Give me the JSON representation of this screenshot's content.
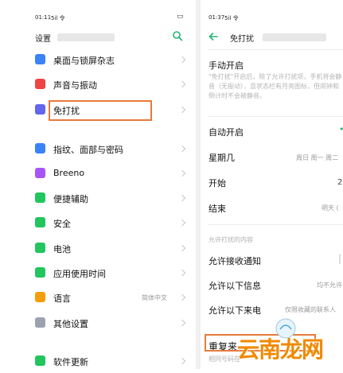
{
  "left": {
    "status_time": "01:11",
    "status_signal": "5il 令",
    "status_battery": "▭",
    "title": "设置",
    "items": [
      {
        "label": "桌面与锁屏杂志",
        "color": "#3b82f6"
      },
      {
        "label": "声音与振动",
        "color": "#ef4444"
      },
      {
        "label": "免打扰",
        "color": "#6366f1"
      },
      {
        "label": "指纹、面部与密码",
        "color": "#3b82f6"
      },
      {
        "label": "Breeno",
        "color": "#a855f7"
      },
      {
        "label": "便捷辅助",
        "color": "#22c55e"
      },
      {
        "label": "安全",
        "color": "#22c55e"
      },
      {
        "label": "电池",
        "color": "#22c55e"
      },
      {
        "label": "应用使用时间",
        "color": "#22c55e"
      },
      {
        "label": "语言",
        "color": "#f59e0b",
        "value": "简体中文"
      },
      {
        "label": "其他设置",
        "color": "#9ca3af"
      },
      {
        "label": "软件更新",
        "color": "#22c55e"
      }
    ]
  },
  "right": {
    "status_time": "01:37",
    "status_signal": "5il 令",
    "title": "免打扰",
    "manual_label": "手动开启",
    "manual_desc": "\"免打扰\"开启后，除了允许打扰项，手机将会静音（无振动），且状态栏有月亮图标，但闹钟和倒计时不会被静音。",
    "auto_label": "自动开启",
    "weekday_label": "星期几",
    "weekday_value": "周日 周一 周二",
    "start_label": "开始",
    "start_value": "2",
    "end_label": "结束",
    "end_value": "明天 (",
    "section_label": "允许打扰的内容",
    "allow_notify": "允许接收通知",
    "allow_msg": "允许以下信息",
    "allow_msg_value": "均不允许",
    "allow_call": "允许以下来电",
    "allow_call_value": "仅限收藏的联系人",
    "repeat_label": "重复来",
    "repeat_desc": "相同号码在"
  },
  "watermark": "云南龙网"
}
